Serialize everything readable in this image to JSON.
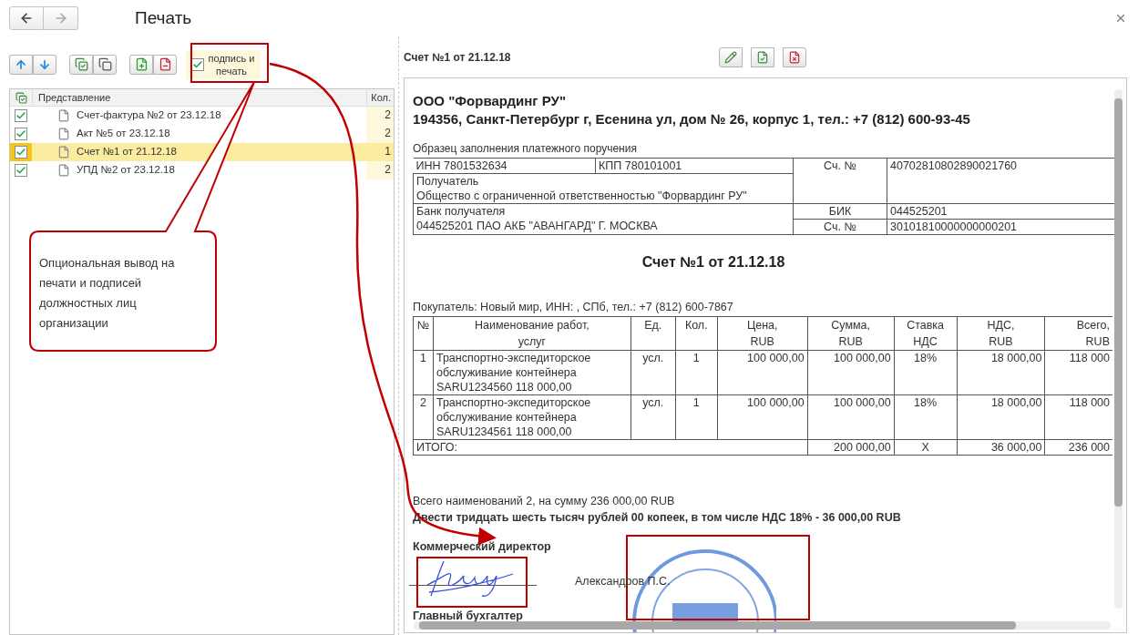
{
  "window": {
    "title": "Печать"
  },
  "print_options": {
    "label": "подпись и печать",
    "checked": true
  },
  "documents_list": {
    "columns": [
      "Представление",
      "Кол."
    ],
    "rows": [
      {
        "name": "Счет-фактура №2 от 23.12.18",
        "count": "2",
        "checked": true,
        "selected": false
      },
      {
        "name": "Акт №5 от 23.12.18",
        "count": "2",
        "checked": true,
        "selected": false
      },
      {
        "name": "Счет №1 от 21.12.18",
        "count": "1",
        "checked": true,
        "selected": true
      },
      {
        "name": "УПД №2 от 23.12.18",
        "count": "2",
        "checked": true,
        "selected": false
      }
    ]
  },
  "preview": {
    "title": "Счет №1 от 21.12.18",
    "document": {
      "company": "ООО \"Форвардинг РУ\"",
      "address": "194356, Санкт-Петербург г, Есенина ул, дом № 26, корпус 1, тел.: +7 (812) 600-93-45",
      "payment_caption": "Образец заполнения платежного поручения",
      "bank": {
        "inn": "ИНН 7801532634",
        "kpp": "КПП 780101001",
        "recipient_label": "Получатель",
        "recipient": "Общество с ограниченной ответственностью \"Форвардинг РУ\"",
        "account_label": "Сч. №",
        "account": "40702810802890021760",
        "bank_label": "Банк получателя",
        "bank_name": "044525201 ПАО АКБ \"АВАНГАРД\" Г. МОСКВА",
        "bik_label": "БИК",
        "bik": "044525201",
        "corr_label": "Сч. №",
        "corr_account": "30101810000000000201"
      },
      "invoice_title": "Счет №1 от 21.12.18",
      "buyer": "Покупатель: Новый мир, ИНН: , СПб, тел.: +7 (812) 600-7867",
      "items": {
        "columns": [
          "№",
          "Наименование работ,\nуслуг",
          "Ед.",
          "Кол.",
          "Цена,\nRUB",
          "Сумма,\nRUB",
          "Ставка\nНДС",
          "НДС,\nRUB",
          "Всего,\nRUB"
        ],
        "rows": [
          [
            "1",
            "Транспортно-экспедиторское\nобслуживание контейнера\nSARU1234560 118 000,00",
            "усл.",
            "1",
            "100 000,00",
            "100 000,00",
            "18%",
            "18 000,00",
            "118 000"
          ],
          [
            "2",
            "Транспортно-экспедиторское\nобслуживание контейнера\nSARU1234561 118 000,00",
            "усл.",
            "1",
            "100 000,00",
            "100 000,00",
            "18%",
            "18 000,00",
            "118 000"
          ]
        ],
        "total": {
          "label": "ИТОГО:",
          "sum": "200 000,00",
          "rate": "Х",
          "vat": "36 000,00",
          "total": "236 000"
        }
      },
      "summary": "Всего наименований 2, на сумму 236 000,00 RUB",
      "amount_words": "Двести тридцать шесть тысяч рублей 00 копеек, в том числе НДС 18% - 36 000,00 RUB",
      "signatures": [
        {
          "title": "Коммерческий директор",
          "name": "Александров П.С."
        },
        {
          "title": "Главный бухгалтер"
        }
      ]
    }
  },
  "annotation": {
    "callout": "Опциональная вывод на печати и подписей должностных лиц организации"
  }
}
